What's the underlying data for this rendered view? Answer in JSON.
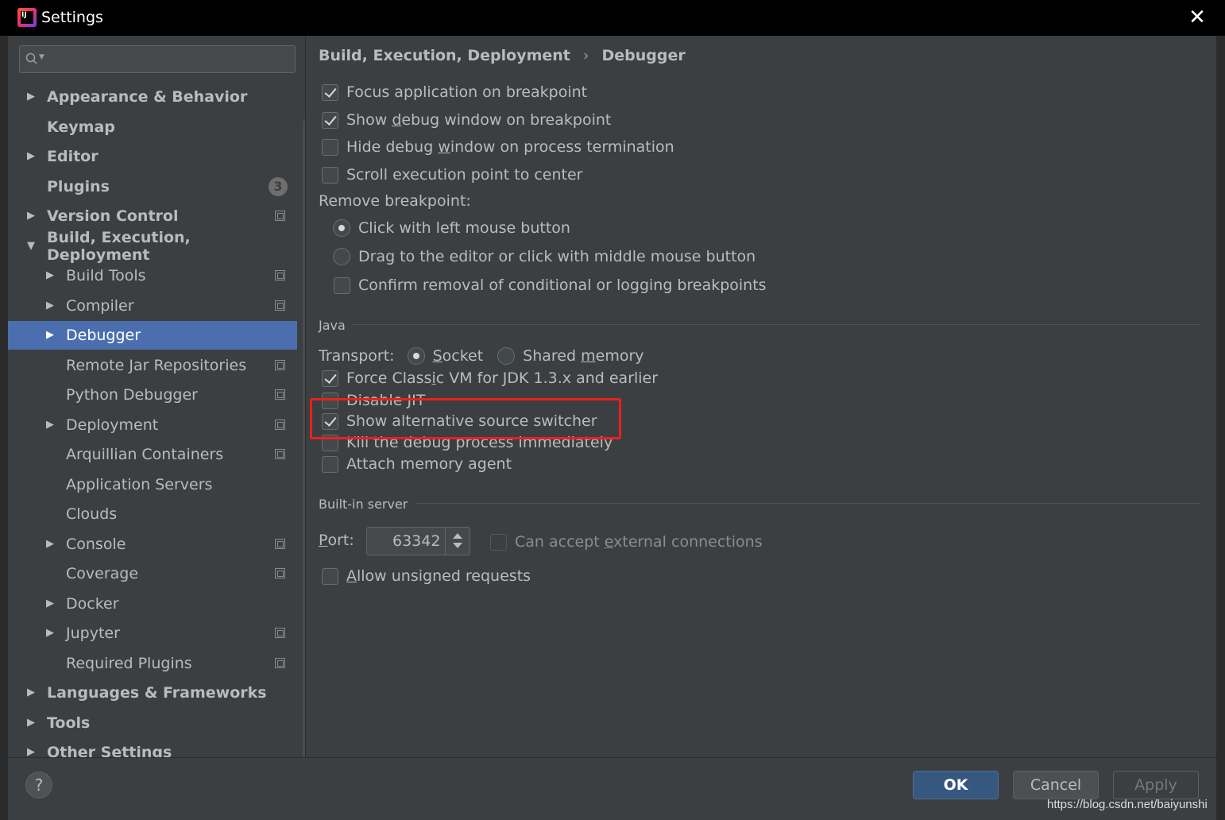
{
  "window": {
    "title": "Settings",
    "app_icon_label": "IJ"
  },
  "search": {
    "placeholder": ""
  },
  "sidebar": {
    "items": [
      {
        "label": "Appearance & Behavior",
        "level": 0,
        "expandable": true,
        "expanded": false,
        "bold": true
      },
      {
        "label": "Keymap",
        "level": 0,
        "expandable": false,
        "bold": true
      },
      {
        "label": "Editor",
        "level": 0,
        "expandable": true,
        "expanded": false,
        "bold": true
      },
      {
        "label": "Plugins",
        "level": 0,
        "expandable": false,
        "bold": true,
        "badge": "3"
      },
      {
        "label": "Version Control",
        "level": 0,
        "expandable": true,
        "expanded": false,
        "bold": true,
        "project_icon": true
      },
      {
        "label": "Build, Execution, Deployment",
        "level": 0,
        "expandable": true,
        "expanded": true,
        "bold": true
      },
      {
        "label": "Build Tools",
        "level": 1,
        "expandable": true,
        "project_icon": true
      },
      {
        "label": "Compiler",
        "level": 1,
        "expandable": true,
        "project_icon": true
      },
      {
        "label": "Debugger",
        "level": 1,
        "expandable": true,
        "selected": true
      },
      {
        "label": "Remote Jar Repositories",
        "level": 1,
        "expandable": false,
        "project_icon": true
      },
      {
        "label": "Python Debugger",
        "level": 1,
        "expandable": false,
        "project_icon": true
      },
      {
        "label": "Deployment",
        "level": 1,
        "expandable": true,
        "project_icon": true
      },
      {
        "label": "Arquillian Containers",
        "level": 1,
        "expandable": false,
        "project_icon": true
      },
      {
        "label": "Application Servers",
        "level": 1,
        "expandable": false
      },
      {
        "label": "Clouds",
        "level": 1,
        "expandable": false
      },
      {
        "label": "Console",
        "level": 1,
        "expandable": true,
        "project_icon": true
      },
      {
        "label": "Coverage",
        "level": 1,
        "expandable": false,
        "project_icon": true
      },
      {
        "label": "Docker",
        "level": 1,
        "expandable": true
      },
      {
        "label": "Jupyter",
        "level": 1,
        "expandable": true,
        "project_icon": true
      },
      {
        "label": "Required Plugins",
        "level": 1,
        "expandable": false,
        "project_icon": true
      },
      {
        "label": "Languages & Frameworks",
        "level": 0,
        "expandable": true,
        "bold": true
      },
      {
        "label": "Tools",
        "level": 0,
        "expandable": true,
        "bold": true
      },
      {
        "label": "Other Settings",
        "level": 0,
        "expandable": true,
        "bold": true
      }
    ]
  },
  "breadcrumb": {
    "parent": "Build, Execution, Deployment",
    "separator": "›",
    "current": "Debugger"
  },
  "general": {
    "focus_app": {
      "label": "Focus application on breakpoint",
      "checked": true
    },
    "show_debug_pre": "Show ",
    "show_debug_mnemonic": "d",
    "show_debug_post": "ebug window on breakpoint",
    "show_debug_checked": true,
    "hide_debug_pre": "Hide debug ",
    "hide_debug_mnemonic": "w",
    "hide_debug_post": "indow on process termination",
    "hide_debug_checked": false,
    "scroll_exec": {
      "label": "Scroll execution point to center",
      "checked": false
    }
  },
  "remove_breakpoint": {
    "label": "Remove breakpoint:",
    "click_left": {
      "label": "Click with left mouse button",
      "selected": true
    },
    "drag_editor": {
      "label": "Drag to the editor or click with middle mouse button",
      "selected": false
    },
    "confirm_removal": {
      "label": "Confirm removal of conditional or logging breakpoints",
      "checked": false
    }
  },
  "java": {
    "section_label": "Java",
    "transport_label": "Transport:",
    "socket_mnemonic": "S",
    "socket_rest": "ocket",
    "socket_selected": true,
    "shared_pre": "Shared ",
    "shared_mnemonic": "m",
    "shared_post": "emory",
    "shared_selected": false,
    "force_classic_pre": "Force Class",
    "force_classic_mnemonic": "i",
    "force_classic_post": "c VM for JDK 1.3.x and earlier",
    "force_classic_checked": true,
    "disable_jit": {
      "label": "Disable JIT",
      "checked": false
    },
    "show_alt_source": {
      "label": "Show alternative source switcher",
      "checked": true
    },
    "kill_debug": {
      "label": "Kill the debug process immediately",
      "checked": false
    },
    "attach_memory": {
      "label": "Attach memory agent",
      "checked": false
    }
  },
  "builtin_server": {
    "section_label": "Built-in server",
    "port_mnemonic": "P",
    "port_rest": "ort:",
    "port_value": "63342",
    "accept_pre": "Can accept ",
    "accept_mnemonic": "e",
    "accept_post": "xternal connections",
    "accept_checked": false,
    "allow_mnemonic": "A",
    "allow_rest": "llow unsigned requests",
    "allow_checked": false
  },
  "footer": {
    "help_label": "?",
    "ok_label": "OK",
    "cancel_label": "Cancel",
    "apply_label": "Apply"
  },
  "watermark": "https://blog.csdn.net/baiyunshi",
  "colors": {
    "background": "#3c3f41",
    "selection": "#4b6eaf",
    "ok_button": "#365880",
    "highlight_box": "#e9201e",
    "text": "#bbbbbb"
  }
}
